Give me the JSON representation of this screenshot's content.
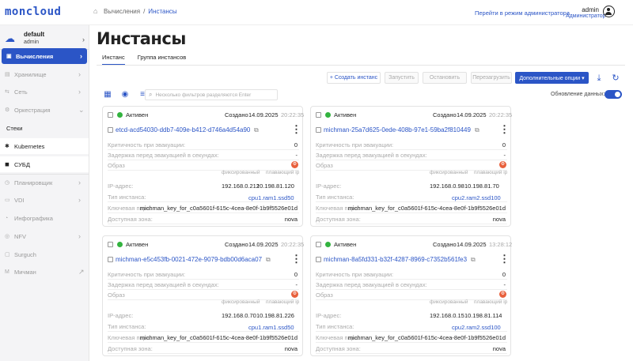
{
  "app": {
    "logo": "moncloud"
  },
  "breadcrumb": {
    "parent": "Вычисления",
    "separator": "/",
    "current": "Инстансы"
  },
  "header": {
    "admin_link": "Перейти в режим администратора",
    "user_name": "admin",
    "user_role": "Администратор"
  },
  "project": {
    "name": "default",
    "user": "admin"
  },
  "sidebar": {
    "items": [
      {
        "label": "Вычисления",
        "icon": "compute-icon"
      },
      {
        "label": "Хранилище",
        "icon": "storage-icon"
      },
      {
        "label": "Сеть",
        "icon": "network-icon"
      },
      {
        "label": "Оркестрация",
        "icon": "orchestration-icon"
      },
      {
        "label": "Стеки"
      },
      {
        "label": "Kubernetes",
        "icon": "kubernetes-icon"
      },
      {
        "label": "СУБД",
        "icon": "database-icon"
      },
      {
        "label": "Планировщик",
        "icon": "scheduler-icon"
      },
      {
        "label": "VDI",
        "icon": "vdi-icon"
      },
      {
        "label": "Инфографика",
        "icon": "infographics-icon"
      },
      {
        "label": "NFV",
        "icon": "nfv-icon"
      },
      {
        "label": "Surguch",
        "icon": "surguch-icon"
      },
      {
        "label": "Мичман",
        "icon": "michman-icon"
      }
    ]
  },
  "page": {
    "title": "Инстансы",
    "tabs": [
      "Инстанс",
      "Группа инстансов"
    ]
  },
  "toolbar": {
    "create": "+ Создать инстанс",
    "start": "Запустить",
    "stop": "Остановить",
    "restart": "Перезагрузить",
    "more": "Дополнительные опции ▾"
  },
  "filter": {
    "placeholder": "Несколько фильтров разделяются Enter"
  },
  "auto_update": {
    "label": "Обновление данных:",
    "enabled": true
  },
  "card_labels": {
    "created": "Создано",
    "evac_priority": "Критичность при эвакуации:",
    "evac_delay": "Задержка перед эвакуацией в секундах:",
    "image": "Образ",
    "fixed": "фиксированный",
    "floating": "плавающий ip",
    "ip": "IP-адрес:",
    "instance_type": "Тип инстанса:",
    "key_pair": "Ключевая пара:",
    "zone": "Доступная зона:"
  },
  "instances": [
    {
      "status": "Активен",
      "date": "14.09.2025",
      "time": "20:22:35",
      "name": "etcd-acd54030-ddb7-409e-b412-d746a4d54a90",
      "evac_priority": "0",
      "evac_delay": "-",
      "fixed_ip": "192.168.0.212",
      "floating_ip": "10.198.81.120",
      "flavor": "cpu1.ram1.ssd50",
      "key_pair": "michman_key_for_c0a5601f-615c-4cea-8e0f-1b9f5526e01d",
      "zone": "nova"
    },
    {
      "status": "Активен",
      "date": "14.09.2025",
      "time": "20:22:35",
      "name": "michman-25a7d625-0ede-408b-97e1-59ba2f810449",
      "evac_priority": "0",
      "evac_delay": "-",
      "fixed_ip": "192.168.0.98",
      "floating_ip": "10.198.81.70",
      "flavor": "cpu2.ram2.ssd100",
      "key_pair": "michman_key_for_c0a5601f-615c-4cea-8e0f-1b9f5526e01d",
      "zone": "nova"
    },
    {
      "status": "Активен",
      "date": "14.09.2025",
      "time": "20:22:35",
      "name": "michman-e5c453fb-0021-472e-9079-bdb00d6aca07",
      "evac_priority": "0",
      "evac_delay": "-",
      "fixed_ip": "192.168.0.70",
      "floating_ip": "10.198.81.226",
      "flavor": "cpu1.ram1.ssd50",
      "key_pair": "michman_key_for_c0a5601f-615c-4cea-8e0f-1b9f5526e01d",
      "zone": "nova"
    },
    {
      "status": "Активен",
      "date": "14.09.2025",
      "time": "13:28:12",
      "name": "michman-8a5fd331-b32f-4287-8969-c7352b561fe3",
      "evac_priority": "0",
      "evac_delay": "-",
      "fixed_ip": "192.168.0.15",
      "floating_ip": "10.198.81.114",
      "flavor": "cpu2.ram2.ssd100",
      "key_pair": "michman_key_for_c0a5601f-615c-4cea-8e0f-1b9f5526e01d",
      "zone": "nova"
    }
  ],
  "colors": {
    "accent": "#2b55c6",
    "status_active": "#33b33f",
    "image_icon": "#e8603c"
  }
}
